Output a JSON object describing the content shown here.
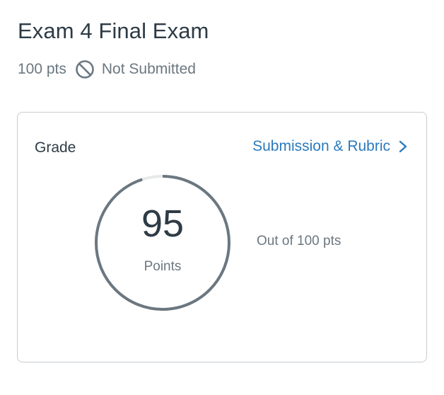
{
  "assignment": {
    "title": "Exam 4 Final Exam",
    "points": "100 pts",
    "status": "Not Submitted",
    "status_icon": "prohibited-circle-icon"
  },
  "grade_card": {
    "label": "Grade",
    "link_label": "Submission & Rubric",
    "link_icon": "chevron-right-icon",
    "score": "95",
    "score_unit": "Points",
    "out_of": "Out of 100 pts",
    "score_fraction": 0.95,
    "colors": {
      "ring": "#6b7780",
      "ring_track": "#e6e8ea",
      "link": "#2b7abc"
    }
  }
}
